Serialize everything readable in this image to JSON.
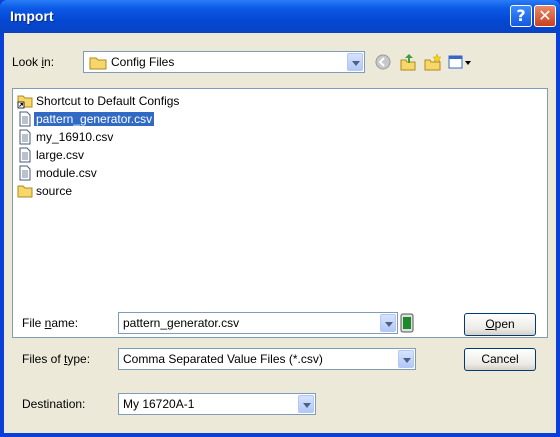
{
  "window": {
    "title": "Import"
  },
  "look_in": {
    "label_pre": "Look ",
    "label_accel": "i",
    "label_post": "n:",
    "value": "Config Files"
  },
  "files": [
    {
      "name": "Shortcut to Default Configs",
      "icon": "folder-shortcut-icon",
      "selected": false
    },
    {
      "name": "pattern_generator.csv",
      "icon": "csv-file-icon",
      "selected": true
    },
    {
      "name": "my_16910.csv",
      "icon": "csv-file-icon",
      "selected": false
    },
    {
      "name": "large.csv",
      "icon": "csv-file-icon",
      "selected": false
    },
    {
      "name": "module.csv",
      "icon": "csv-file-icon",
      "selected": false
    },
    {
      "name": "source",
      "icon": "folder-icon",
      "selected": false
    }
  ],
  "file_name": {
    "label_pre": "File ",
    "label_accel": "n",
    "label_post": "ame:",
    "value": "pattern_generator.csv"
  },
  "file_type": {
    "label_pre": "Files of ",
    "label_accel": "t",
    "label_post": "ype:",
    "value": "Comma Separated Value Files (*.csv)"
  },
  "destination": {
    "label": "Destination:",
    "value": "My 16720A-1"
  },
  "buttons": {
    "open_accel": "O",
    "open_rest": "pen",
    "cancel": "Cancel"
  },
  "colors": {
    "title_bar": "#0548d4",
    "dialog_bg": "#ece9d8",
    "selection": "#316ac5",
    "field_border": "#7f9db9"
  }
}
